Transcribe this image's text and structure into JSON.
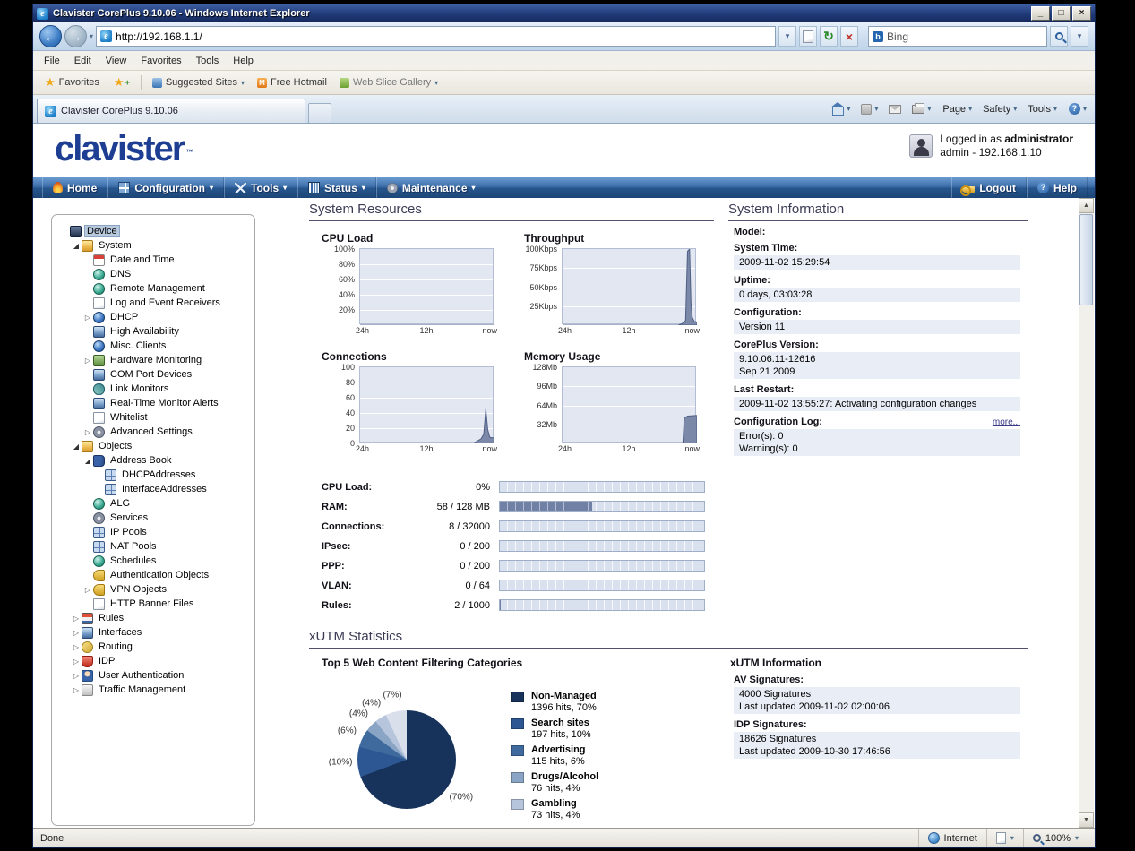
{
  "browser": {
    "title": "Clavister CorePlus 9.10.06 - Windows Internet Explorer",
    "address": "http://192.168.1.1/",
    "search_text": "Bing",
    "menu": [
      "File",
      "Edit",
      "View",
      "Favorites",
      "Tools",
      "Help"
    ],
    "favorites_label": "Favorites",
    "favorites_items": [
      {
        "label": "Suggested Sites",
        "caret": true,
        "icon": "suggested-sites",
        "dim": false
      },
      {
        "label": "Free Hotmail",
        "caret": false,
        "icon": "hotmail",
        "dim": false
      },
      {
        "label": "Web Slice Gallery",
        "caret": true,
        "icon": "web-slice",
        "dim": true
      }
    ],
    "tab_title": "Clavister CorePlus 9.10.06",
    "command_buttons": [
      {
        "label": "Page"
      },
      {
        "label": "Safety"
      },
      {
        "label": "Tools"
      }
    ],
    "status_text": "Done",
    "zone_label": "Internet",
    "zoom_level": "100%"
  },
  "page": {
    "logo_text": "clavister",
    "logo_tm": "™",
    "login": {
      "prefix": "Logged in as ",
      "user": "administrator",
      "line2": "admin - 192.168.1.10"
    },
    "nav_left": [
      {
        "label": "Home",
        "icon": "home",
        "caret": false
      },
      {
        "label": "Configuration",
        "icon": "configuration",
        "caret": true
      },
      {
        "label": "Tools",
        "icon": "tools",
        "caret": true
      },
      {
        "label": "Status",
        "icon": "status",
        "caret": true
      },
      {
        "label": "Maintenance",
        "icon": "maintenance",
        "caret": true
      }
    ],
    "nav_right": [
      {
        "label": "Logout",
        "icon": "logout",
        "caret": false
      },
      {
        "label": "Help",
        "icon": "help",
        "caret": false
      }
    ]
  },
  "sidebar": {
    "tree": [
      {
        "label": "Device",
        "level": 0,
        "icon": "device",
        "selected": true
      },
      {
        "label": "System",
        "level": 1,
        "icon": "folder",
        "expand": "open"
      },
      {
        "label": "Date and Time",
        "level": 2,
        "icon": "clock"
      },
      {
        "label": "DNS",
        "level": 2,
        "icon": "sphere"
      },
      {
        "label": "Remote Management",
        "level": 2,
        "icon": "sphere"
      },
      {
        "label": "Log and Event Receivers",
        "level": 2,
        "icon": "page"
      },
      {
        "label": "DHCP",
        "level": 2,
        "icon": "globe",
        "expand": "closed"
      },
      {
        "label": "High Availability",
        "level": 2,
        "icon": "screen"
      },
      {
        "label": "Misc. Clients",
        "level": 2,
        "icon": "globe"
      },
      {
        "label": "Hardware Monitoring",
        "level": 2,
        "icon": "chip",
        "expand": "closed"
      },
      {
        "label": "COM Port Devices",
        "level": 2,
        "icon": "screen"
      },
      {
        "label": "Link Monitors",
        "level": 2,
        "icon": "link"
      },
      {
        "label": "Real-Time Monitor Alerts",
        "level": 2,
        "icon": "screen"
      },
      {
        "label": "Whitelist",
        "level": 2,
        "icon": "page"
      },
      {
        "label": "Advanced Settings",
        "level": 2,
        "icon": "gear",
        "expand": "closed"
      },
      {
        "label": "Objects",
        "level": 1,
        "icon": "folder",
        "expand": "open"
      },
      {
        "label": "Address Book",
        "level": 2,
        "icon": "book",
        "expand": "open"
      },
      {
        "label": "DHCPAddresses",
        "level": 3,
        "icon": "grid"
      },
      {
        "label": "InterfaceAddresses",
        "level": 3,
        "icon": "grid"
      },
      {
        "label": "ALG",
        "level": 2,
        "icon": "sphere"
      },
      {
        "label": "Services",
        "level": 2,
        "icon": "gear"
      },
      {
        "label": "IP Pools",
        "level": 2,
        "icon": "grid"
      },
      {
        "label": "NAT Pools",
        "level": 2,
        "icon": "grid"
      },
      {
        "label": "Schedules",
        "level": 2,
        "icon": "sphere"
      },
      {
        "label": "Authentication Objects",
        "level": 2,
        "icon": "key"
      },
      {
        "label": "VPN Objects",
        "level": 2,
        "icon": "key",
        "expand": "closed"
      },
      {
        "label": "HTTP Banner Files",
        "level": 2,
        "icon": "page"
      },
      {
        "label": "Rules",
        "level": 1,
        "icon": "layers",
        "expand": "closed"
      },
      {
        "label": "Interfaces",
        "level": 1,
        "icon": "screen",
        "expand": "closed"
      },
      {
        "label": "Routing",
        "level": 1,
        "icon": "route",
        "expand": "closed"
      },
      {
        "label": "IDP",
        "level": 1,
        "icon": "shield",
        "expand": "closed"
      },
      {
        "label": "User Authentication",
        "level": 1,
        "icon": "user",
        "expand": "closed"
      },
      {
        "label": "Traffic Management",
        "level": 1,
        "icon": "traffic",
        "expand": "closed"
      }
    ]
  },
  "sections": {
    "system_resources_title": "System Resources",
    "system_info_title": "System Information",
    "xutm_title": "xUTM Statistics",
    "top5_title": "Top 5 Web Content Filtering Categories",
    "xutm_info_title": "xUTM Information"
  },
  "gauges": [
    {
      "label": "CPU Load:",
      "value": "0%",
      "frac": 0
    },
    {
      "label": "RAM:",
      "value": "58 / 128 MB",
      "frac": 0.453
    },
    {
      "label": "Connections:",
      "value": "8 / 32000",
      "frac": 0
    },
    {
      "label": "IPsec:",
      "value": "0 / 200",
      "frac": 0
    },
    {
      "label": "PPP:",
      "value": "0 / 200",
      "frac": 0
    },
    {
      "label": "VLAN:",
      "value": "0 / 64",
      "frac": 0
    },
    {
      "label": "Rules:",
      "value": "2 / 1000",
      "frac": 0.002
    }
  ],
  "system_info": [
    {
      "label": "Model:",
      "lines": []
    },
    {
      "label": "System Time:",
      "lines": [
        "2009-11-02 15:29:54"
      ]
    },
    {
      "label": "Uptime:",
      "lines": [
        "0 days, 03:03:28"
      ]
    },
    {
      "label": "Configuration:",
      "lines": [
        "Version 11"
      ]
    },
    {
      "label": "CorePlus Version:",
      "lines": [
        "9.10.06.11-12616",
        "Sep 21 2009"
      ]
    },
    {
      "label": "Last Restart:",
      "lines": [
        "2009-11-02 13:55:27: Activating configuration changes"
      ]
    },
    {
      "label": "Configuration Log:",
      "link": "more...",
      "lines": [
        "Error(s): 0",
        "Warning(s): 0"
      ]
    }
  ],
  "xutm_info": [
    {
      "label": "AV Signatures:",
      "lines": [
        "4000 Signatures",
        "Last updated 2009-11-02 02:00:06"
      ]
    },
    {
      "label": "IDP Signatures:",
      "lines": [
        "18626 Signatures",
        "Last updated 2009-10-30 17:46:56"
      ]
    }
  ],
  "chart_data": [
    {
      "type": "area",
      "title": "CPU Load",
      "x": [
        "24h",
        "12h",
        "now"
      ],
      "ylim": [
        0,
        100
      ],
      "yticks": [
        {
          "label": "100%",
          "f": 0
        },
        {
          "label": "80%",
          "f": 0.2
        },
        {
          "label": "60%",
          "f": 0.4
        },
        {
          "label": "40%",
          "f": 0.6
        },
        {
          "label": "20%",
          "f": 0.8
        }
      ],
      "points": [
        [
          0,
          0
        ],
        [
          1,
          0
        ]
      ]
    },
    {
      "type": "area",
      "title": "Throughput",
      "x": [
        "24h",
        "12h",
        "now"
      ],
      "ylim": [
        0,
        100
      ],
      "yticks": [
        {
          "label": "100Kbps",
          "f": 0
        },
        {
          "label": "75Kbps",
          "f": 0.25
        },
        {
          "label": "50Kbps",
          "f": 0.5
        },
        {
          "label": "25Kbps",
          "f": 0.75
        }
      ],
      "points": [
        [
          0,
          0
        ],
        [
          0.86,
          0
        ],
        [
          0.89,
          2
        ],
        [
          0.915,
          6
        ],
        [
          0.93,
          97
        ],
        [
          0.945,
          100
        ],
        [
          0.955,
          30
        ],
        [
          0.965,
          10
        ],
        [
          0.98,
          5
        ],
        [
          1,
          4
        ]
      ]
    },
    {
      "type": "area",
      "title": "Connections",
      "x": [
        "24h",
        "12h",
        "now"
      ],
      "ylim": [
        0,
        100
      ],
      "yticks": [
        {
          "label": "100",
          "f": 0
        },
        {
          "label": "80",
          "f": 0.2
        },
        {
          "label": "60",
          "f": 0.4
        },
        {
          "label": "40",
          "f": 0.6
        },
        {
          "label": "20",
          "f": 0.8
        },
        {
          "label": "0",
          "f": 1
        }
      ],
      "points": [
        [
          0,
          0
        ],
        [
          0.84,
          0
        ],
        [
          0.87,
          3
        ],
        [
          0.9,
          6
        ],
        [
          0.92,
          12
        ],
        [
          0.935,
          45
        ],
        [
          0.95,
          18
        ],
        [
          0.965,
          8
        ],
        [
          1,
          7
        ]
      ]
    },
    {
      "type": "area",
      "title": "Memory Usage",
      "x": [
        "24h",
        "12h",
        "now"
      ],
      "ylim": [
        0,
        128
      ],
      "yticks": [
        {
          "label": "128Mb",
          "f": 0
        },
        {
          "label": "96Mb",
          "f": 0.25
        },
        {
          "label": "64Mb",
          "f": 0.5
        },
        {
          "label": "32Mb",
          "f": 0.75
        }
      ],
      "points": [
        [
          0,
          0
        ],
        [
          0.895,
          0
        ],
        [
          0.905,
          42
        ],
        [
          0.93,
          46
        ],
        [
          1,
          47
        ]
      ]
    },
    {
      "type": "pie",
      "title": "Top 5 Web Content Filtering Categories",
      "slices": [
        {
          "label": "Non-Managed",
          "hits": 1396,
          "pct": 70,
          "color": "#17335c",
          "legend": true
        },
        {
          "label": "Search sites",
          "hits": 197,
          "pct": 10,
          "color": "#2d5792",
          "legend": true
        },
        {
          "label": "Advertising",
          "hits": 115,
          "pct": 6,
          "color": "#3f6a9e",
          "legend": true
        },
        {
          "label": "Drugs/Alcohol",
          "hits": 76,
          "pct": 4,
          "color": "#8aa4c6",
          "legend": true
        },
        {
          "label": "Gambling",
          "hits": 73,
          "pct": 4,
          "color": "#b6c5dc",
          "legend": true
        },
        {
          "label": "Other",
          "hits": null,
          "pct": 7,
          "color": "#d9dfeb",
          "legend": false
        }
      ]
    }
  ]
}
